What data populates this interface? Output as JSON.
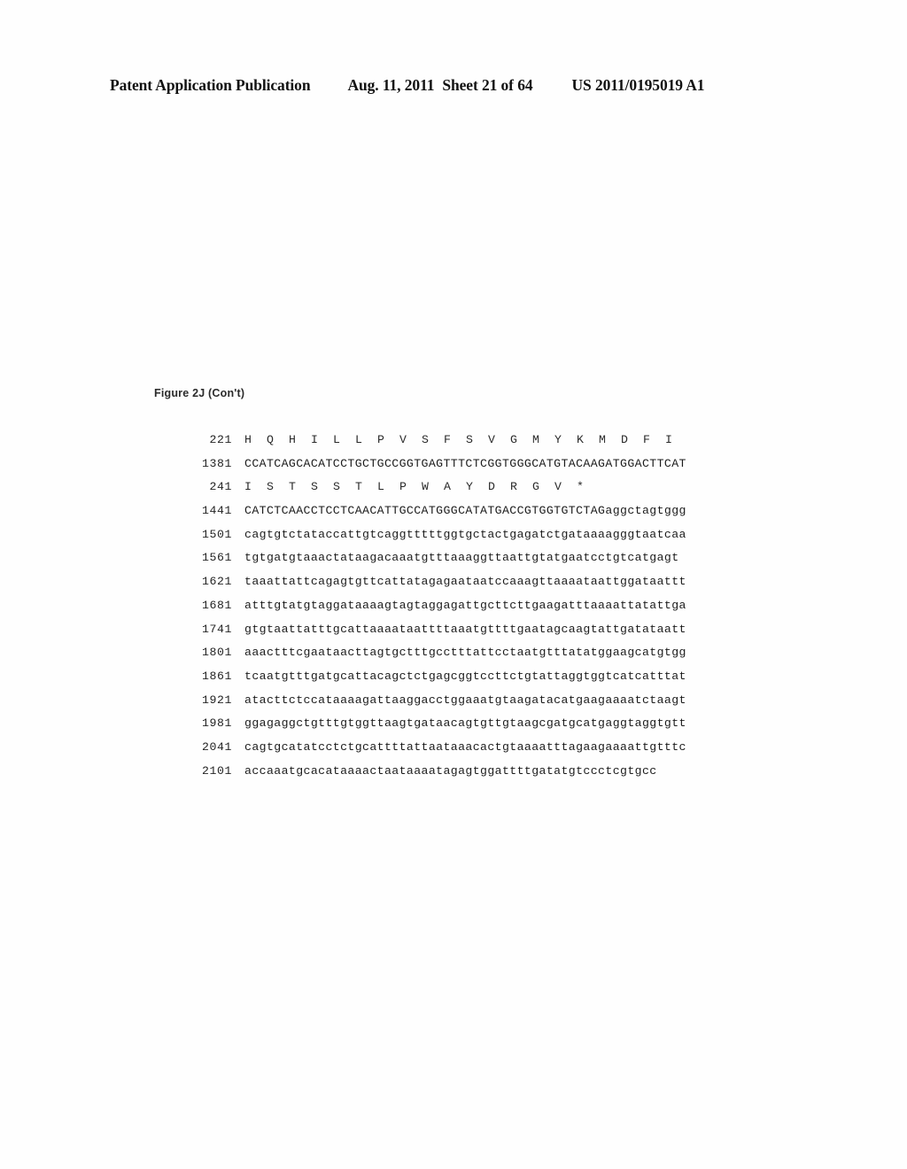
{
  "header": {
    "publication_label": "Patent Application Publication",
    "date": "Aug. 11, 2011",
    "sheet": "Sheet 21 of 64",
    "publication_number": "US 2011/0195019 A1"
  },
  "figure": {
    "caption": "Figure 2J (Con't)"
  },
  "sequence": {
    "rows": [
      {
        "index": "221",
        "type": "protein",
        "text": "H  Q  H  I  L  L  P  V  S  F  S  V  G  M  Y  K  M  D  F  I"
      },
      {
        "index": "1381",
        "type": "nucleotide",
        "text": "CCATCAGCACATCCTGCTGCCGGTGAGTTTCTCGGTGGGCATGTACAAGATGGACTTCAT"
      },
      {
        "index": "241",
        "type": "protein",
        "text": "I  S  T  S  S  T  L  P  W  A  Y  D  R  G  V  *"
      },
      {
        "index": "1441",
        "type": "nucleotide",
        "text": "CATCTCAACCTCCTCAACATTGCCATGGGCATATGACCGTGGTGTCTAGaggctagtggg"
      },
      {
        "index": "1501",
        "type": "nucleotide",
        "text": "cagtgtctataccattgtcaggtttttggtgctactgagatctgataaaagggtaatcaa"
      },
      {
        "index": "1561",
        "type": "nucleotide",
        "text": "tgtgatgtaaactataagacaaatgtttaaaggttaattgtatgaatcctgtcatgagt"
      },
      {
        "index": "1621",
        "type": "nucleotide",
        "text": "taaattattcagagtgttcattatagagaataatccaaagttaaaataattggataattt"
      },
      {
        "index": "1681",
        "type": "nucleotide",
        "text": "atttgtatgtaggataaaagtagtaggagattgcttcttgaagatttaaaattatattga"
      },
      {
        "index": "1741",
        "type": "nucleotide",
        "text": "gtgtaattatttgcattaaaataattttaaatgttttgaatagcaagtattgatataatt"
      },
      {
        "index": "1801",
        "type": "nucleotide",
        "text": "aaactttcgaataacttagtgctttgcctttattcctaatgtttatatggaagcatgtgg"
      },
      {
        "index": "1861",
        "type": "nucleotide",
        "text": "tcaatgtttgatgcattacagctctgagcggtccttctgtattaggtggtcatcatttat"
      },
      {
        "index": "1921",
        "type": "nucleotide",
        "text": "atacttctccataaaagattaaggacctggaaatgtaagatacatgaagaaaatctaagt"
      },
      {
        "index": "1981",
        "type": "nucleotide",
        "text": "ggagaggctgtttgtggttaagtgataacagtgttgtaagcgatgcatgaggtaggtgtt"
      },
      {
        "index": "2041",
        "type": "nucleotide",
        "text": "cagtgcatatcctctgcattttattaataaacactgtaaaatttagaagaaaattgtttc"
      },
      {
        "index": "2101",
        "type": "nucleotide",
        "text": "accaaatgcacataaaactaataaaatagagtggattttgatatgtccctcgtgcc"
      }
    ]
  }
}
